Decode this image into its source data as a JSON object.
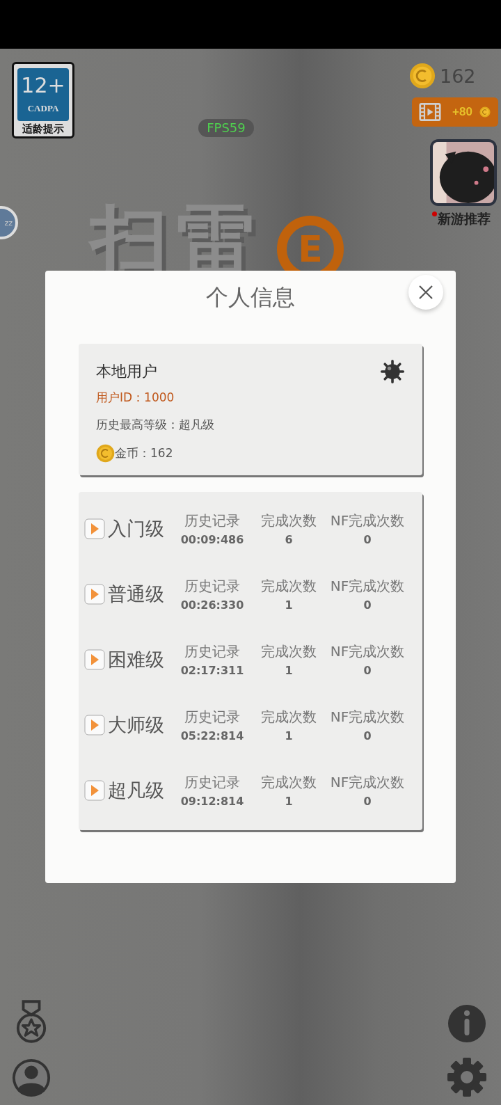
{
  "age_badge": {
    "rating": "12+",
    "org": "CADPA",
    "label": "适龄提示"
  },
  "fps": "FPS59",
  "coins": {
    "amount": "162"
  },
  "video_reward": {
    "amount": "+80"
  },
  "new_game": {
    "label": "新游推荐",
    "notification": true
  },
  "side_button": {
    "label": "zz"
  },
  "logo": {
    "title": "扫雷",
    "badge": "E"
  },
  "dialog": {
    "title": "个人信息",
    "user": {
      "name": "本地用户",
      "id": "用户ID：1000",
      "best_level": "历史最高等级：超凡级",
      "coins": "金币：162"
    },
    "levels": [
      {
        "name": "入门级",
        "record_label": "历史记录",
        "record": "00:09:486",
        "count_label": "完成次数",
        "count": "6",
        "nf_label": "NF完成次数",
        "nf_count": "0"
      },
      {
        "name": "普通级",
        "record_label": "历史记录",
        "record": "00:26:330",
        "count_label": "完成次数",
        "count": "1",
        "nf_label": "NF完成次数",
        "nf_count": "0"
      },
      {
        "name": "困难级",
        "record_label": "历史记录",
        "record": "02:17:311",
        "count_label": "完成次数",
        "count": "1",
        "nf_label": "NF完成次数",
        "nf_count": "0"
      },
      {
        "name": "大师级",
        "record_label": "历史记录",
        "record": "05:22:814",
        "count_label": "完成次数",
        "count": "1",
        "nf_label": "NF完成次数",
        "nf_count": "0"
      },
      {
        "name": "超凡级",
        "record_label": "历史记录",
        "record": "09:12:814",
        "count_label": "完成次数",
        "count": "1",
        "nf_label": "NF完成次数",
        "nf_count": "0"
      }
    ]
  }
}
